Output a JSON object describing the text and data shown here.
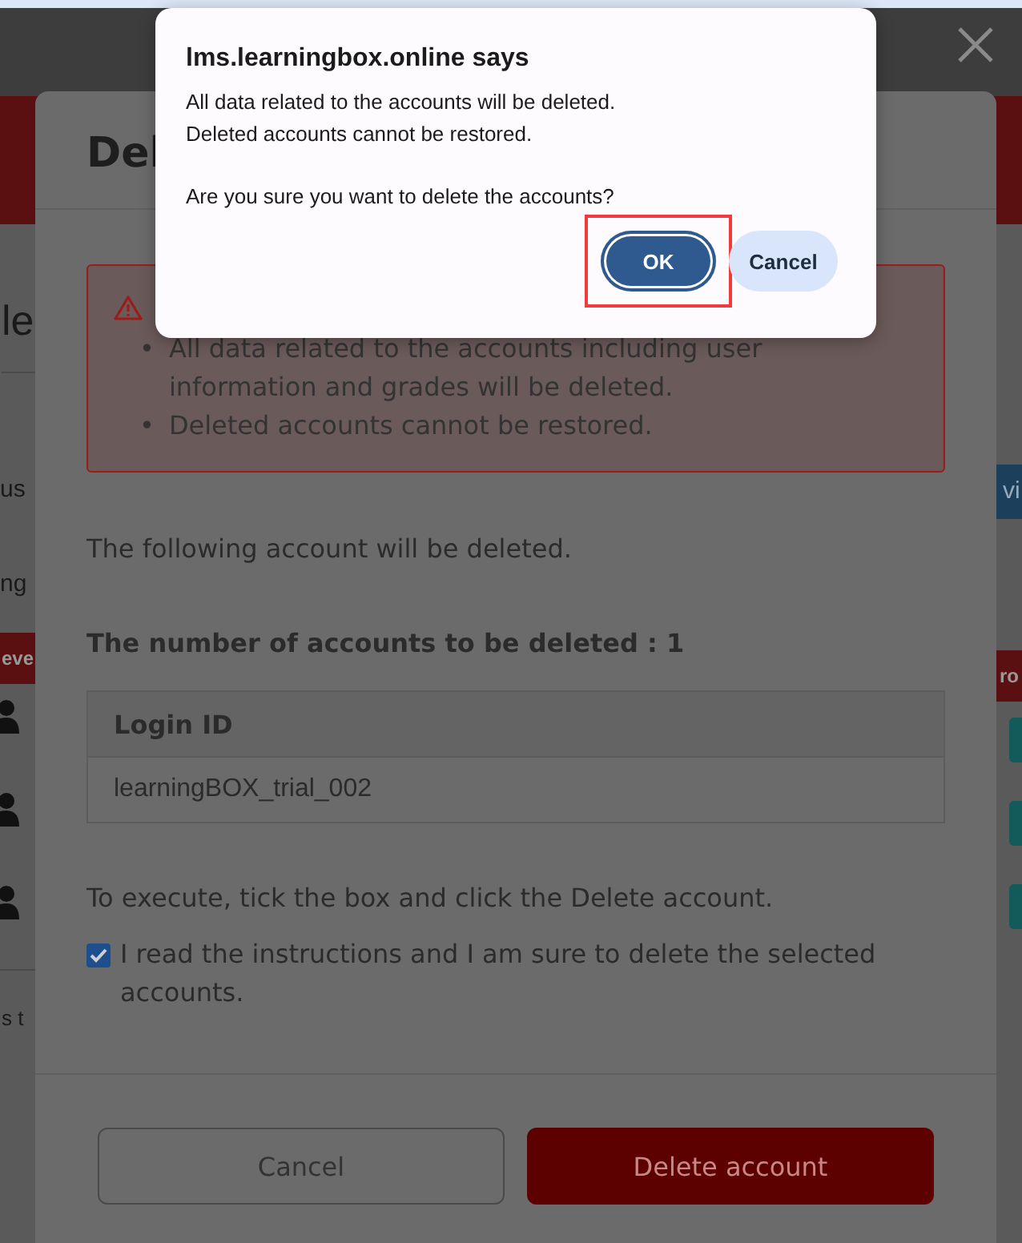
{
  "background_page": {
    "fragments_left": [
      {
        "text": "le",
        "kind": "heading"
      },
      {
        "text": "us",
        "kind": "text"
      },
      {
        "text": "ng",
        "kind": "text"
      },
      {
        "text": "eve",
        "kind": "header"
      },
      {
        "text": "s t",
        "kind": "text"
      }
    ],
    "fragments_right": [
      {
        "text": "vi",
        "kind": "button"
      },
      {
        "text": "ro",
        "kind": "header"
      }
    ]
  },
  "modal": {
    "title": "Del",
    "warning": {
      "bullet": "•",
      "items": [
        "All data related to the accounts including user information and grades will be deleted.",
        "Deleted accounts cannot be restored."
      ]
    },
    "intro": "The following account will be deleted.",
    "count_label": "The number of accounts to be deleted : 1",
    "table": {
      "columns": [
        "Login ID"
      ],
      "rows": [
        [
          "learningBOX_trial_002"
        ]
      ]
    },
    "instruction": "To execute, tick the box and click the Delete account.",
    "confirm": {
      "label": "I read the instructions and I am sure to delete the selected accounts.",
      "checked": true
    },
    "buttons": [
      {
        "label": "Cancel",
        "kind": "secondary"
      },
      {
        "label": "Delete account",
        "kind": "danger"
      }
    ]
  },
  "browser_dialog": {
    "title": "lms.learningbox.online says",
    "lines": [
      "All data related to the accounts will be deleted.",
      "Deleted accounts cannot be restored."
    ],
    "question": "Are you sure you want to delete the accounts?",
    "buttons": [
      {
        "label": "OK",
        "kind": "primary",
        "highlighted": true
      },
      {
        "label": "Cancel",
        "kind": "secondary",
        "highlighted": false
      }
    ]
  }
}
